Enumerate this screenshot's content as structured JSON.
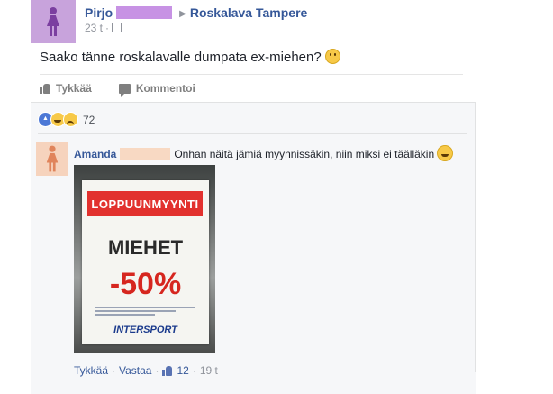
{
  "post": {
    "author": "Pirjo",
    "group": "Roskalava Tampere",
    "time": "23 t",
    "text": "Saako tänne roskalavalle dumpata ex-miehen?",
    "like_label": "Tykkää",
    "comment_label": "Kommentoi",
    "reaction_count": "72"
  },
  "comment": {
    "author": "Amanda",
    "text": "Onhan näitä jämiä myynnissäkin, niin miksi ei täälläkin",
    "sign": {
      "banner": "LOPPUUNMYYNTI",
      "line1": "MIEHET",
      "line2": "-50%",
      "brand": "INTERSPORT"
    },
    "like_label": "Tykkää",
    "reply_label": "Vastaa",
    "like_count": "12",
    "time": "19 t"
  },
  "colors": {
    "link": "#365899",
    "author_avatar": "#c8a3dc",
    "commenter_avatar": "#f6d3bd",
    "sign_red": "#e2312e"
  }
}
